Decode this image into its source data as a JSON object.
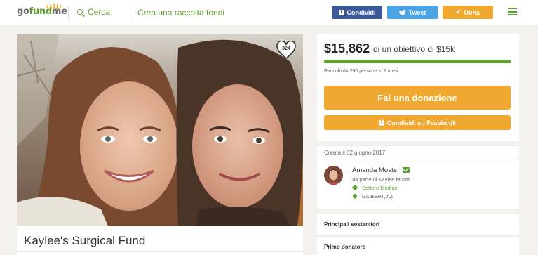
{
  "header": {
    "logo": {
      "part1": "go",
      "part2": "fund",
      "part3": "me"
    },
    "search_label": "Cerca",
    "create_label": "Crea una raccolta fondi",
    "share_facebook_label": "Condividi",
    "tweet_label": "Tweet",
    "donate_label": "Dona"
  },
  "campaign": {
    "title": "Kaylee's Surgical Fund",
    "hearts_count": "324"
  },
  "donation": {
    "amount": "$15,862",
    "goal_text": "di un obiettivo di $15k",
    "progress": 1.0,
    "raised_by": "Raccolti da 290 persone in 2 mesi",
    "donate_button": "Fai una donazione",
    "share_facebook_button": "Condividi su Facebook"
  },
  "organizer": {
    "created": "Creata il 02 giugno 2017",
    "name": "Amanda Moats",
    "on_behalf": "da parte di Kaylee Moats",
    "category": "Settore Medico",
    "location": "GILBERT, AZ"
  },
  "sections": {
    "top_supporters": "Principali sostenitori",
    "first_donor": "Primo donatore"
  },
  "colors": {
    "brand_green": "#5fa032",
    "facebook_blue": "#3b5998",
    "twitter_blue": "#4ba3e6",
    "donate_orange": "#f0a830"
  },
  "icons": {
    "search": "search-icon",
    "menu": "hamburger-menu-icon",
    "heart": "heart-icon",
    "facebook": "facebook-icon",
    "twitter": "twitter-icon",
    "check": "check-icon",
    "mail": "mail-icon",
    "tag": "tag-icon",
    "location": "location-pin-icon"
  }
}
